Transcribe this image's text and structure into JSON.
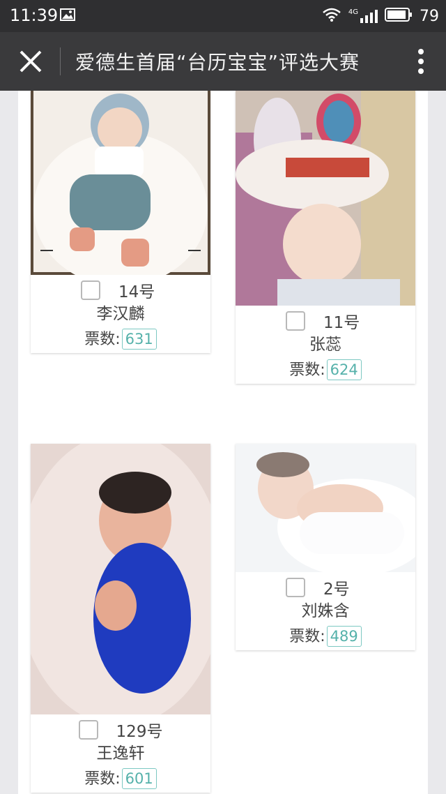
{
  "status_bar": {
    "time": "11:39",
    "network": "4G",
    "battery": "79"
  },
  "nav": {
    "title": "爱德生首届“台历宝宝”评选大赛"
  },
  "contestants": [
    {
      "number": "14号",
      "name": "李汉麟",
      "votes_label": "票数:",
      "votes": "631"
    },
    {
      "number": "11号",
      "name": "张蕊",
      "votes_label": "票数:",
      "votes": "624"
    },
    {
      "number": "129号",
      "name": "王逸轩",
      "votes_label": "票数:",
      "votes": "601"
    },
    {
      "number": "2号",
      "name": "刘姝含",
      "votes_label": "票数:",
      "votes": "489"
    }
  ],
  "colors": {
    "status_bar": "#2f2f31",
    "nav_bar": "#3a3a3c",
    "vote_accent": "#55b1aa"
  }
}
